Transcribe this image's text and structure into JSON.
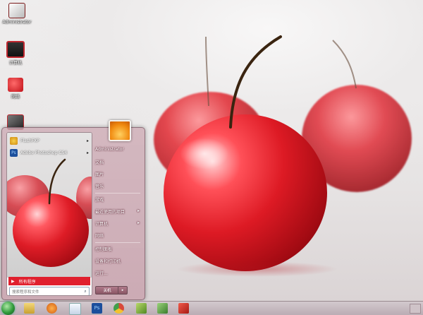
{
  "desktop": {
    "icons": [
      {
        "name": "admin-folder-icon",
        "label": "Administrator"
      },
      {
        "name": "computer-icon",
        "label": "计算机"
      },
      {
        "name": "network-icon",
        "label": "网络"
      },
      {
        "name": "recycle-bin-icon",
        "label": ""
      }
    ]
  },
  "start_menu": {
    "pinned": [
      {
        "name": "flashfxp",
        "label": "FlashFXP",
        "icon": "flashfxp-icon",
        "color": "#e8b020"
      },
      {
        "name": "photoshop",
        "label": "Adobe Photoshop CS4",
        "icon": "photoshop-icon",
        "color": "#1c4f9c"
      }
    ],
    "all_programs": "所有程序",
    "search_placeholder": "搜索程序和文件",
    "right": [
      {
        "key": "user",
        "label": "Administrator"
      },
      {
        "key": "docs",
        "label": "文档"
      },
      {
        "key": "pics",
        "label": "图片"
      },
      {
        "key": "music",
        "label": "音乐"
      },
      {
        "key": "games",
        "label": "游戏"
      },
      {
        "key": "recent",
        "label": "最近使用的项目",
        "arrow": true
      },
      {
        "key": "computer",
        "label": "计算机",
        "arrow": true
      },
      {
        "key": "network",
        "label": "网络"
      },
      {
        "key": "control",
        "label": "控制面板"
      },
      {
        "key": "devices",
        "label": "设备和打印机"
      },
      {
        "key": "run",
        "label": "运行..."
      }
    ],
    "shutdown": "关机"
  },
  "taskbar": {
    "items": [
      {
        "name": "taskbar-explorer-icon",
        "color": "#e7c35a"
      },
      {
        "name": "taskbar-media-player-icon",
        "color": "#e07a20"
      },
      {
        "name": "taskbar-notepad-icon",
        "color": "#dfe7f2"
      },
      {
        "name": "taskbar-photoshop-icon",
        "color": "#1c4f9c"
      },
      {
        "name": "taskbar-chrome-icon",
        "color": "#d84a3a"
      },
      {
        "name": "taskbar-flashfxp-icon",
        "color": "#7bb23a"
      },
      {
        "name": "taskbar-network-icon",
        "color": "#56a04a"
      },
      {
        "name": "taskbar-flash-icon",
        "color": "#c8362a"
      }
    ]
  },
  "colors": {
    "accent": "#e0202e",
    "cherry": "#d8121c"
  }
}
